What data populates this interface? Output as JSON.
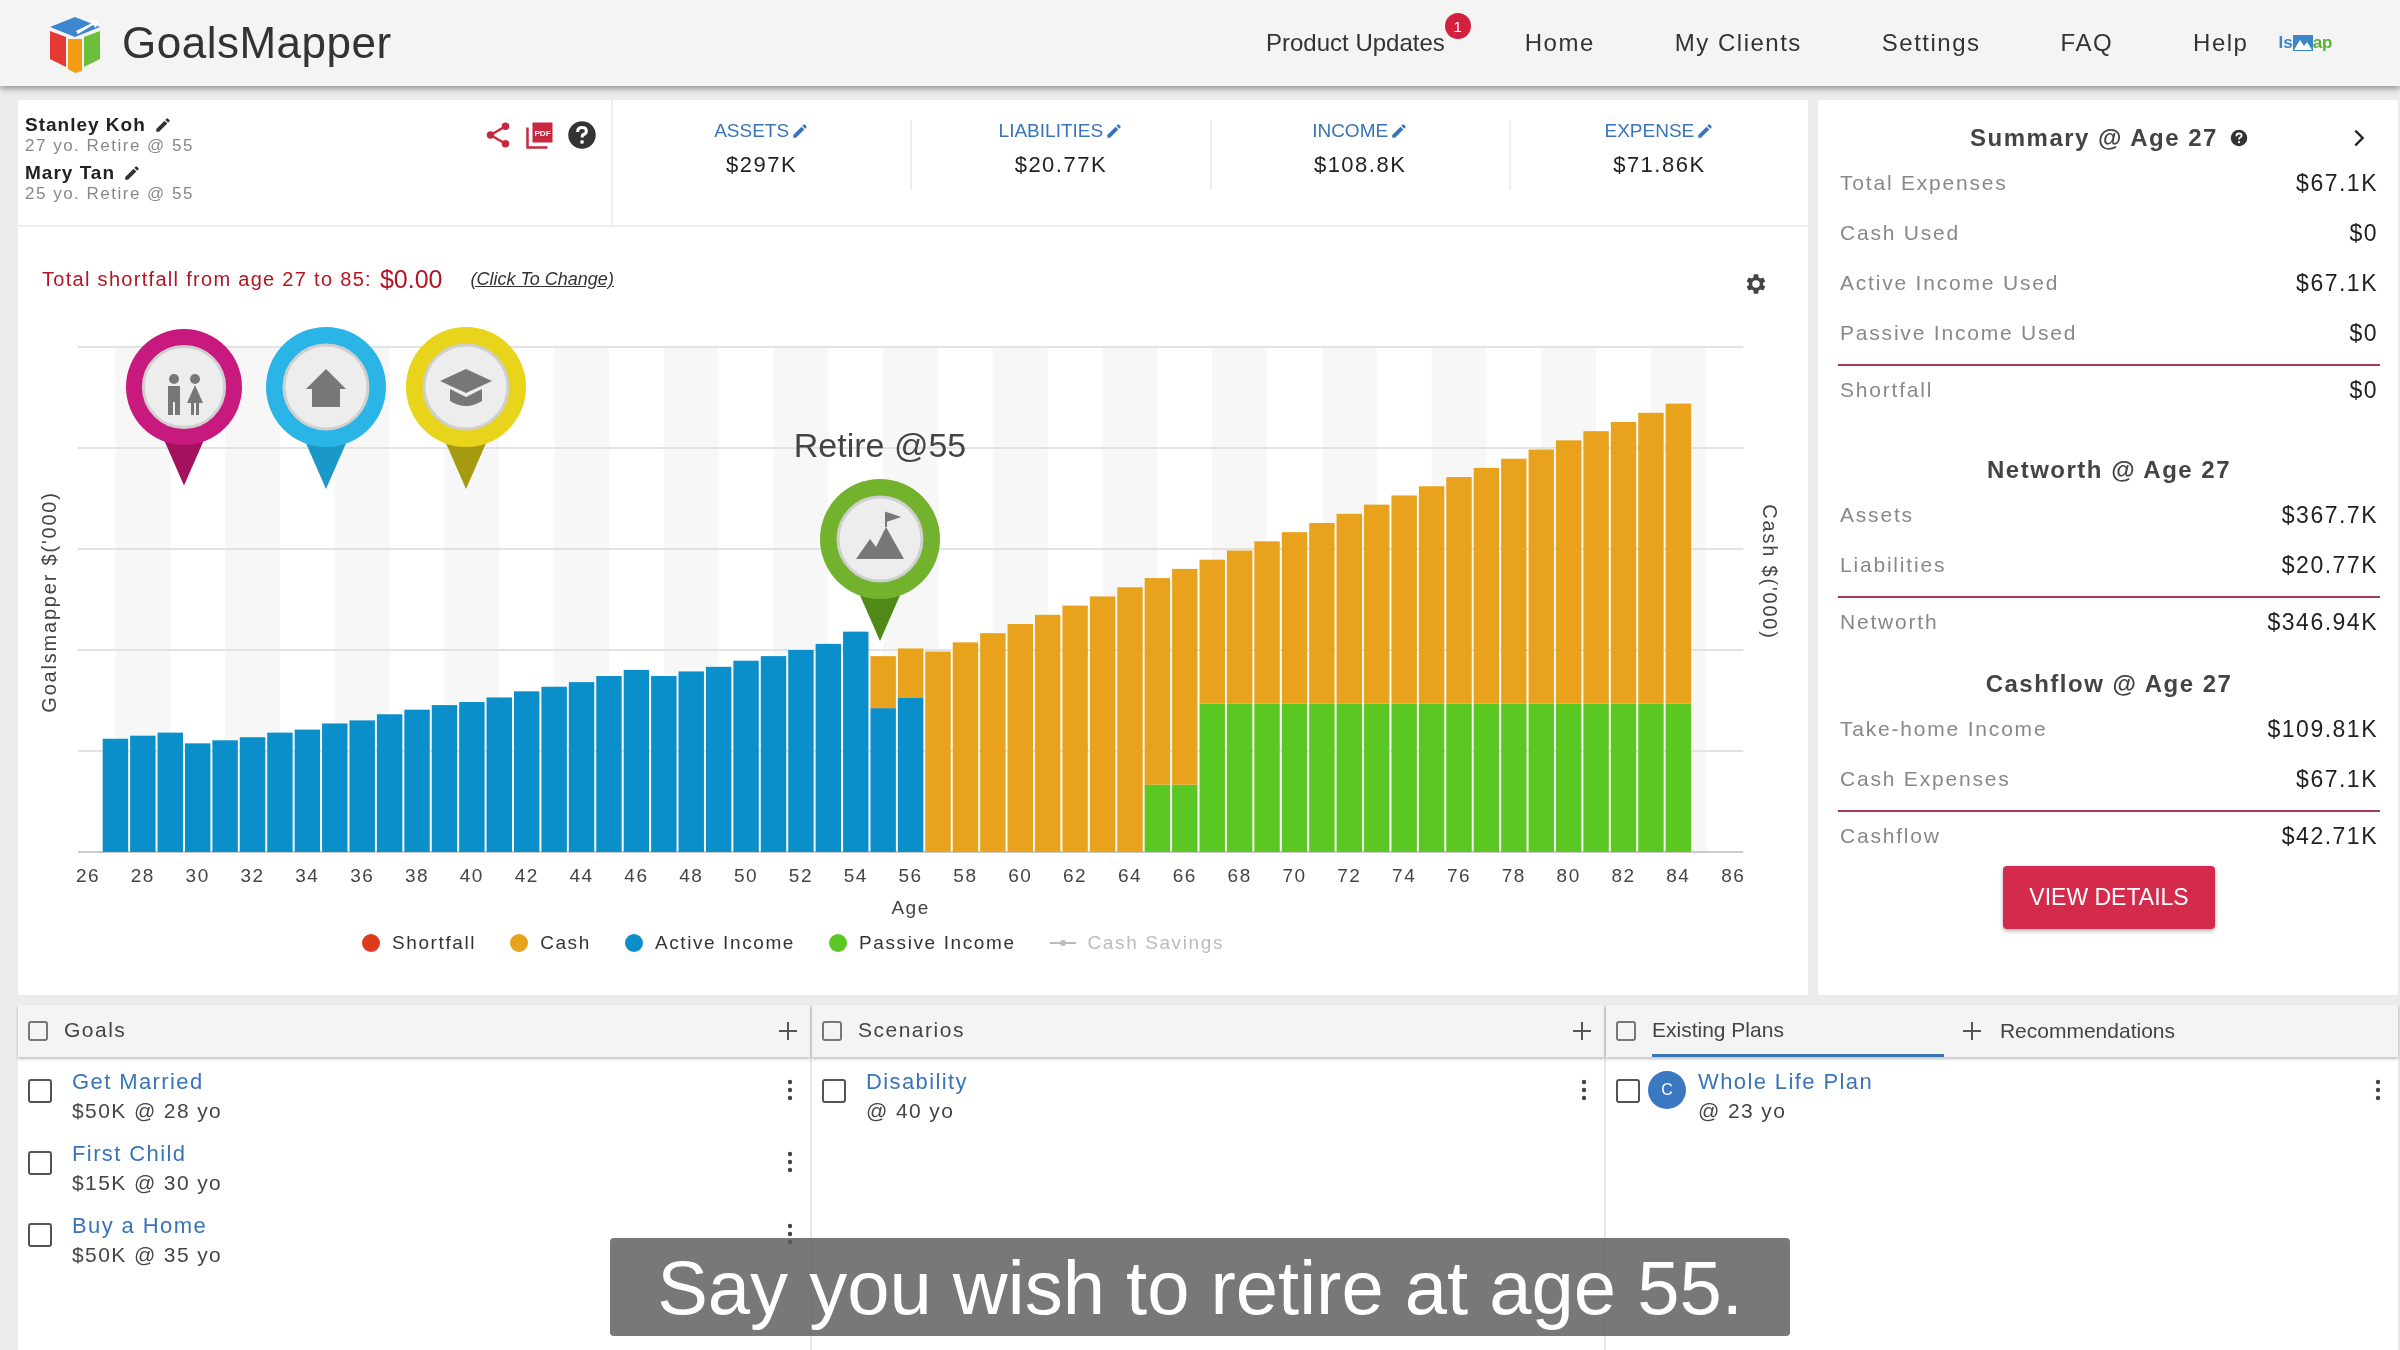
{
  "header": {
    "brand": "GoalsMapper",
    "nav": [
      {
        "label": "Product Updates",
        "badge": "1"
      },
      {
        "label": "Home"
      },
      {
        "label": "My Clients"
      },
      {
        "label": "Settings"
      },
      {
        "label": "FAQ"
      },
      {
        "label": "Help"
      }
    ],
    "partner_logo": {
      "prefix": "Is",
      "suffix": "ap"
    }
  },
  "clients": [
    {
      "name": "Stanley Koh",
      "detail": "27 yo. Retire @ 55"
    },
    {
      "name": "Mary Tan",
      "detail": "25 yo. Retire @ 55"
    }
  ],
  "pdf_label": "PDF",
  "stats": [
    {
      "label": "ASSETS",
      "value": "$297K"
    },
    {
      "label": "LIABILITIES",
      "value": "$20.77K"
    },
    {
      "label": "INCOME",
      "value": "$108.8K"
    },
    {
      "label": "EXPENSE",
      "value": "$71.86K"
    }
  ],
  "shortfall": {
    "text": "Total shortfall from age 27 to 85:",
    "value": "$0.00",
    "link": "(Click To Change)"
  },
  "chart": {
    "y_title": "Goalsmapper $('000)",
    "y2_title": "Cash $('000)",
    "x_title": "Age",
    "x_labels": [
      "26",
      "28",
      "30",
      "32",
      "34",
      "36",
      "38",
      "40",
      "42",
      "44",
      "46",
      "48",
      "50",
      "52",
      "54",
      "56",
      "58",
      "60",
      "62",
      "64",
      "66",
      "68",
      "70",
      "72",
      "74",
      "76",
      "78",
      "80",
      "82",
      "84",
      "86"
    ],
    "milestone": "Retire @55",
    "legend": [
      {
        "label": "Shortfall",
        "color": "#dd3b1c",
        "kind": "dot",
        "hidden": false
      },
      {
        "label": "Cash",
        "color": "#e8a21c",
        "kind": "dot",
        "hidden": false
      },
      {
        "label": "Active Income",
        "color": "#0a8fcb",
        "kind": "dot",
        "hidden": false
      },
      {
        "label": "Passive Income",
        "color": "#5ac723",
        "kind": "dot",
        "hidden": false
      },
      {
        "label": "Cash Savings",
        "color": "#bbbbbb",
        "kind": "line",
        "hidden": true
      }
    ]
  },
  "summary": {
    "sections": [
      {
        "title": "Summary @ Age 27",
        "help": true,
        "next": true,
        "rows": [
          {
            "label": "Total Expenses",
            "value": "$67.1K"
          },
          {
            "label": "Cash Used",
            "value": "$0"
          },
          {
            "label": "Active Income Used",
            "value": "$67.1K"
          },
          {
            "label": "Passive Income Used",
            "value": "$0"
          }
        ],
        "total": {
          "label": "Shortfall",
          "value": "$0"
        }
      },
      {
        "title": "Networth @ Age 27",
        "help": false,
        "next": false,
        "rows": [
          {
            "label": "Assets",
            "value": "$367.7K"
          },
          {
            "label": "Liabilities",
            "value": "$20.77K"
          }
        ],
        "total": {
          "label": "Networth",
          "value": "$346.94K"
        }
      },
      {
        "title": "Cashflow @ Age 27",
        "help": false,
        "next": false,
        "rows": [
          {
            "label": "Take-home Income",
            "value": "$109.81K"
          },
          {
            "label": "Cash Expenses",
            "value": "$67.1K"
          }
        ],
        "total": {
          "label": "Cashflow",
          "value": "$42.71K"
        }
      }
    ],
    "button": "VIEW DETAILS"
  },
  "panels": [
    {
      "tabs": [
        {
          "label": "Goals",
          "selected": true
        }
      ],
      "checked": false,
      "items": [
        {
          "title": "Get Married",
          "detail": "$50K @ 28 yo",
          "checked": false
        },
        {
          "title": "First Child",
          "detail": "$15K @ 30 yo",
          "checked": false
        },
        {
          "title": "Buy a Home",
          "detail": "$50K @ 35 yo",
          "checked": false
        }
      ]
    },
    {
      "tabs": [
        {
          "label": "Scenarios",
          "selected": true
        }
      ],
      "checked": false,
      "items": [
        {
          "title": "Disability",
          "detail": "@ 40 yo",
          "checked": false
        }
      ]
    },
    {
      "tabs": [
        {
          "label": "Existing Plans",
          "selected": true
        },
        {
          "label": "Recommendations",
          "selected": false
        }
      ],
      "checked": false,
      "items": [
        {
          "title": "Whole Life Plan",
          "detail": "@ 23 yo",
          "checked": false,
          "avatar": "C"
        }
      ]
    }
  ],
  "caption": "Say you wish to retire at age 55."
}
